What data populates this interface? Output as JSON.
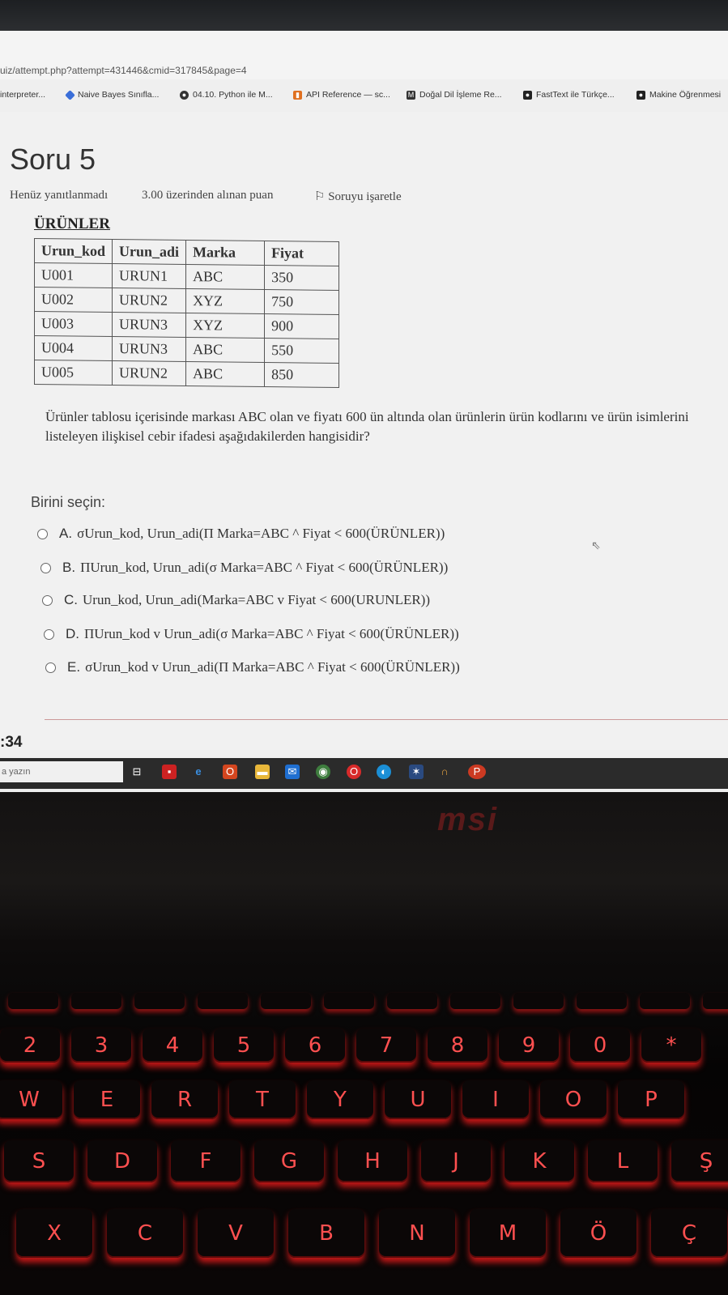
{
  "browser": {
    "url": "uiz/attempt.php?attempt=431446&cmid=317845&page=4",
    "bookmarks": [
      {
        "label": "interpreter..."
      },
      {
        "label": "Naive Bayes Sınıfla..."
      },
      {
        "label": "04.10. Python ile M..."
      },
      {
        "label": "API Reference — sc..."
      },
      {
        "label": "Doğal Dil İşleme Re..."
      },
      {
        "label": "FastText ile Türkçe..."
      },
      {
        "label": "Makine Öğrenmesi"
      }
    ]
  },
  "question": {
    "title": "Soru 5",
    "status": "Henüz yanıtlanmadı",
    "points": "3.00 üzerinden alınan puan",
    "flag_label": "Soruyu işaretle",
    "table_title": "ÜRÜNLER",
    "table_headers": [
      "Urun_kod",
      "Urun_adi",
      "Marka",
      "Fiyat"
    ],
    "table_rows": [
      [
        "U001",
        "URUN1",
        "ABC",
        "350"
      ],
      [
        "U002",
        "URUN2",
        "XYZ",
        "750"
      ],
      [
        "U003",
        "URUN3",
        "XYZ",
        "900"
      ],
      [
        "U004",
        "URUN3",
        "ABC",
        "550"
      ],
      [
        "U005",
        "URUN2",
        "ABC",
        "850"
      ]
    ],
    "text": "Ürünler tablosu içerisinde markası ABC olan ve fiyatı 600 ün altında olan ürünlerin ürün kodlarını ve ürün isimlerini listeleyen ilişkisel cebir ifadesi aşağıdakilerden hangisidir?",
    "choose_label": "Birini seçin:",
    "options": [
      {
        "letter": "A.",
        "text": "σUrun_kod, Urun_adi(Π Marka=ABC ^ Fiyat < 600(ÜRÜNLER))"
      },
      {
        "letter": "B.",
        "text": "ΠUrun_kod, Urun_adi(σ Marka=ABC ^ Fiyat < 600(ÜRÜNLER))"
      },
      {
        "letter": "C.",
        "text": "Urun_kod, Urun_adi(Marka=ABC v Fiyat < 600(URUNLER))"
      },
      {
        "letter": "D.",
        "text": "ΠUrun_kod v Urun_adi(σ Marka=ABC ^ Fiyat < 600(ÜRÜNLER))"
      },
      {
        "letter": "E.",
        "text": "σUrun_kod v Urun_adi(Π Marka=ABC ^ Fiyat < 600(ÜRÜNLER))"
      }
    ]
  },
  "clock": ":34",
  "taskbar": {
    "search_placeholder": "a yazın"
  },
  "laptop": {
    "brand": "msi",
    "keys_row1": [
      "2",
      "3",
      "4",
      "5",
      "6",
      "7",
      "8",
      "9",
      "0",
      "*"
    ],
    "keys_row2": [
      "W",
      "E",
      "R",
      "T",
      "Y",
      "U",
      "I",
      "O",
      "P"
    ],
    "keys_row3": [
      "S",
      "D",
      "F",
      "G",
      "H",
      "J",
      "K",
      "L",
      "Ş"
    ],
    "keys_row4": [
      "X",
      "C",
      "V",
      "B",
      "N",
      "M",
      "Ö",
      "Ç"
    ]
  }
}
